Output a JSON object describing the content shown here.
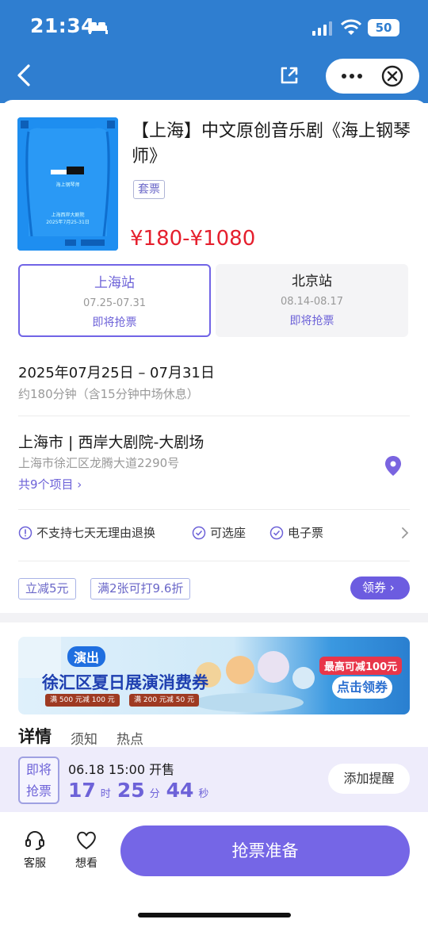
{
  "status_bar": {
    "time": "21:34",
    "battery": "50"
  },
  "show": {
    "title": "【上海】中文原创音乐剧《海上钢琴师》",
    "tag": "套票",
    "price": "¥180-¥1080"
  },
  "poster": {
    "title_text": "海上钢琴师",
    "venue_text": "上海西岸大剧院",
    "date_text": "2025年7月25-31日"
  },
  "stations": [
    {
      "name": "上海站",
      "dates": "07.25-07.31",
      "status": "即将抢票",
      "selected": true
    },
    {
      "name": "北京站",
      "dates": "08.14-08.17",
      "status": "即将抢票",
      "selected": false
    }
  ],
  "schedule": {
    "date": "2025年07月25日 – 07月31日",
    "duration": "约180分钟（含15分钟中场休息）"
  },
  "venue": {
    "name": "上海市 | 西岸大剧院-大剧场",
    "address": "上海市徐汇区龙腾大道2290号",
    "projects": "共9个项目 ›"
  },
  "policies": [
    "不支持七天无理由退换",
    "可选座",
    "电子票"
  ],
  "promos": [
    "立减5元",
    "满2张可打9.6折"
  ],
  "coupon_label": "领券 ›",
  "banner": {
    "tag": "演出",
    "title": "徐汇区夏日展演消费券",
    "chip1": "满 500 元减 100 元",
    "chip2": "满 200 元减 50 元",
    "max": "最高可减100元",
    "cta": "点击领券"
  },
  "tabs": [
    "详情",
    "须知",
    "热点"
  ],
  "sale": {
    "badge_top": "即将",
    "badge_bottom": "抢票",
    "when": "06.18 15:00 开售",
    "hours": "17",
    "hours_unit": "时",
    "minutes": "25",
    "minutes_unit": "分",
    "seconds": "44",
    "seconds_unit": "秒",
    "remind": "添加提醒"
  },
  "bottom_bar": {
    "service": "客服",
    "want": "想看",
    "main": "抢票准备"
  },
  "colors": {
    "header_blue": "#2f7ed0",
    "accent_purple": "#7566e6",
    "price_red": "#e5202e"
  }
}
